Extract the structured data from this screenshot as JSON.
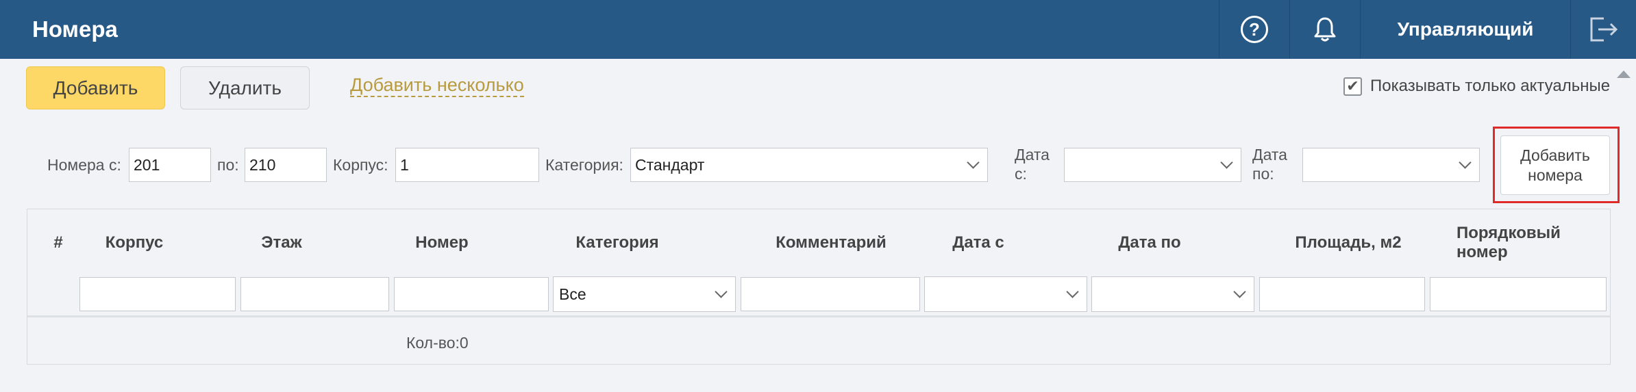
{
  "header": {
    "title": "Номера",
    "help_glyph": "?",
    "user_label": "Управляющий",
    "icons": [
      "help-icon",
      "bell-icon",
      "logout-icon"
    ],
    "bg_color": "#275987"
  },
  "toolbar": {
    "add_label": "Добавить",
    "delete_label": "Удалить",
    "add_many_label": "Добавить несколько",
    "only_actual_label": "Показывать только актуальные",
    "only_actual_checked": true
  },
  "filters": {
    "rooms_from_label": "Номера с:",
    "rooms_from_value": "201",
    "rooms_to_label": "по:",
    "rooms_to_value": "210",
    "building_label": "Корпус:",
    "building_value": "1",
    "category_label": "Категория:",
    "category_value": "Стандарт",
    "date_from_label_1": "Дата",
    "date_from_label_2": "с:",
    "date_from_value": "",
    "date_to_label_1": "Дата",
    "date_to_label_2": "по:",
    "date_to_value": "",
    "add_rooms_label_1": "Добавить",
    "add_rooms_label_2": "номера"
  },
  "table": {
    "columns": [
      "#",
      "Корпус",
      "Этаж",
      "Номер",
      "Категория",
      "Комментарий",
      "Дата с",
      "Дата по",
      "Площадь, м2",
      "Порядковый номер"
    ],
    "column_last_line1": "Порядковый",
    "column_last_line2": "номер",
    "category_filter_value": "Все",
    "count_label": "Кол-во:0"
  }
}
